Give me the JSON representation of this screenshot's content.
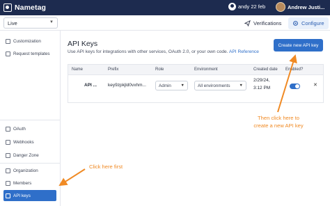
{
  "topbar": {
    "app_name": "Nametag",
    "user_label": "andy 22 feb",
    "account_name": "Andrew Justi..."
  },
  "env_select": {
    "value": "Live"
  },
  "tabs": [
    {
      "label": "Verifications",
      "icon": "send-icon"
    },
    {
      "label": "Configure",
      "icon": "gear-icon"
    }
  ],
  "sidebar": {
    "items": [
      {
        "label": "Customization"
      },
      {
        "label": "Request templates"
      },
      {
        "label": "OAuth"
      },
      {
        "label": "Webhooks"
      },
      {
        "label": "Danger Zone"
      },
      {
        "label": "Organization"
      },
      {
        "label": "Members"
      },
      {
        "label": "API keys"
      }
    ]
  },
  "main": {
    "title": "API Keys",
    "description": "Use API keys for integrations with other services, OAuth 2.0, or your own code.",
    "description_link": "API Reference",
    "create_button": "Create new API key"
  },
  "table": {
    "headers": [
      "Name",
      "Prefix",
      "Role",
      "Environment",
      "Created date",
      "Enabled?"
    ],
    "rows": [
      {
        "name": "API ...",
        "prefix": "key9zpkjld0vxhm...",
        "role": "Admin",
        "environment": "All environments",
        "created_line1": "2/29/24,",
        "created_line2": "3:12 PM",
        "enabled": true
      }
    ]
  },
  "annotations": {
    "first": "Click here first",
    "second_line1": "Then click here to",
    "second_line2": "create a new API key"
  },
  "colors": {
    "topbar": "#1d2b4f",
    "accent": "#2f6fc9",
    "annotation": "#f08a24"
  }
}
